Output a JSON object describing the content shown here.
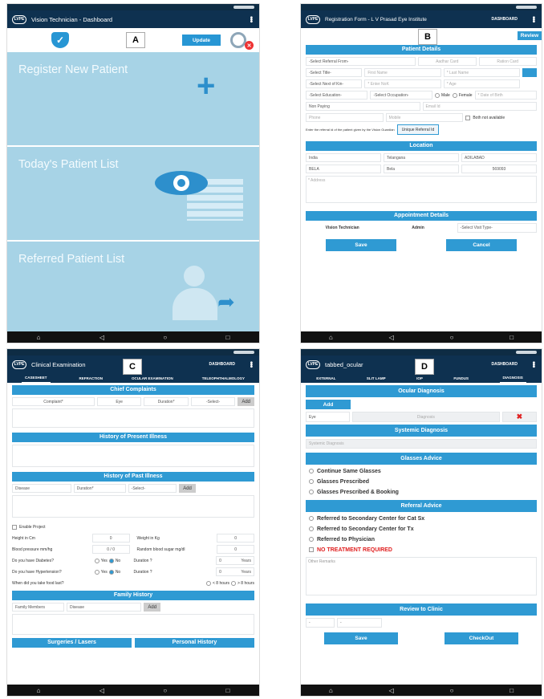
{
  "panelA": {
    "title": "Vision Technician - Dashboard",
    "tag": "A",
    "update_label": "Update",
    "tiles": [
      "Register New Patient",
      "Today's Patient List",
      "Referred Patient List"
    ]
  },
  "panelB": {
    "title": "Registration Form - L V Prasad Eye Institute",
    "dashboard": "DASHBOARD",
    "tag": "B",
    "review_label": "Review",
    "patient_details": "Patient Details",
    "referral_from": "-Select Referral From-",
    "aadhar": "Aadhar Card",
    "ration": "Ration Card",
    "title_sel": "-Select Title-",
    "first_name": "First Name",
    "last_name": "* Last Name",
    "next_of_kin": "-Select Next of Kin-",
    "enter_nok": "* Enter NoK",
    "age": "* Age",
    "education": "-Select Education-",
    "occupation": "-Select Occupation-",
    "male": "Male",
    "female": "Female",
    "dob": "* Date of Birth",
    "non_paying": "Non Paying",
    "email": "Email Id",
    "phone": "Phone",
    "mobile": "Mobile",
    "both_na": "Both not available",
    "referral_hint": "Enter the referral id of the patient given by the Vision Guardian",
    "unique_ref": "Unique Referral Id",
    "location": "Location",
    "country": "India",
    "state": "Telangana",
    "district": "ADILABAD",
    "mandal": "BELA",
    "village": "Bela",
    "pincode": "569093",
    "address": "* Address",
    "appointment": "Appointment Details",
    "role": "Vision Technician",
    "admin": "Admin",
    "visit_type": "-Select Visit Type-",
    "save": "Save",
    "cancel": "Cancel"
  },
  "panelC": {
    "title": "Clinical Examination",
    "dashboard": "DASHBOARD",
    "tag": "C",
    "tabs": [
      "CASESHEET",
      "REFRACTION",
      "OCULAR EXAMINATION",
      "TELEOPHTHALMOLOGY"
    ],
    "chief": "Chief Complaints",
    "complaint": "Complaint*",
    "eye": "Eye",
    "duration": "Duration*",
    "select": "-Select-",
    "add": "Add",
    "hpi": "History of Present Illness",
    "hpast": "History of Past Illness",
    "disease": "Disease",
    "enable_project": "Enable Project",
    "height": "Height in Cm",
    "zero": "0",
    "weight": "Weight in Kg",
    "bp": "Blood pressure mm/hg",
    "bp_val": "0 / 0",
    "rbs": "Random blood sugar mg/dl",
    "diabetes": "Do you have Diabetes?",
    "yes": "Yes",
    "no": "No",
    "duration_q": "Duration ?",
    "years": "Years",
    "hypertension": "Do you have Hypertension?",
    "food": "When did you take food last?",
    "lt8": "< 8 hours",
    "gt8": "> 8 hours",
    "family": "Family History",
    "members": "Family Members",
    "surgeries": "Surgeries / Lasers",
    "personal": "Personal History"
  },
  "panelD": {
    "title": "tabbed_ocular",
    "dashboard": "DASHBOARD",
    "tag": "D",
    "tabs": [
      "EXTERNAL",
      "SLIT LAMP",
      "IOP",
      "FUNDUS",
      "DIAGNOSIS"
    ],
    "ocular": "Ocular Diagnosis",
    "add": "Add",
    "eye": "Eye",
    "diagnosis": "Diagnosis",
    "systemic": "Systemic Diagnosis",
    "systemic_ph": "Systemic Diagnosis",
    "glasses": "Glasses Advice",
    "g1": "Continue Same Glasses",
    "g2": "Glasses Prescribed",
    "g3": "Glasses Prescribed & Booking",
    "referral": "Referral Advice",
    "r1": "Referred to Secondary Center for Cat Sx",
    "r2": "Referred to Secondary Center for Tx",
    "r3": "Referred to Physician",
    "no_treatment": "NO TREATMENT REQUIRED",
    "remarks": "Other Remarks",
    "review": "Review to Clinic",
    "dash1": "-",
    "dash2": "-",
    "save": "Save",
    "checkout": "CheckOut"
  },
  "nav": {
    "back": "◁",
    "home": "○",
    "recent": "□",
    "up": "⌂"
  },
  "colors": {
    "accent": "#2f9ad3",
    "appbar": "#0e3150",
    "tile": "#a7d3e6",
    "danger": "#e02020"
  }
}
